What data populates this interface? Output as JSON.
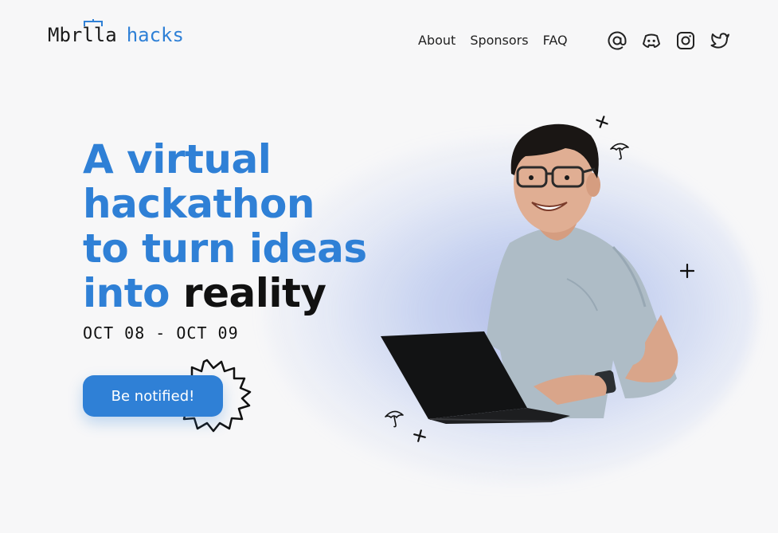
{
  "header": {
    "logo_brand": "Mbrlla",
    "logo_suffix": "hacks",
    "nav": [
      {
        "label": "About"
      },
      {
        "label": "Sponsors"
      },
      {
        "label": "FAQ"
      }
    ],
    "socials": [
      {
        "icon": "at-sign-icon"
      },
      {
        "icon": "discord-icon"
      },
      {
        "icon": "instagram-icon"
      },
      {
        "icon": "twitter-icon"
      }
    ]
  },
  "hero": {
    "headline_lines": [
      "A virtual",
      "hackathon",
      "to turn ideas",
      "into"
    ],
    "headline_emphasis": "reality",
    "dates": "OCT 08 - OCT 09",
    "cta_label": "Be notified!",
    "image_alt": "Smiling student with a laptop"
  },
  "colors": {
    "accent": "#2f80d6",
    "text": "#111111",
    "background": "#f7f7f8"
  }
}
